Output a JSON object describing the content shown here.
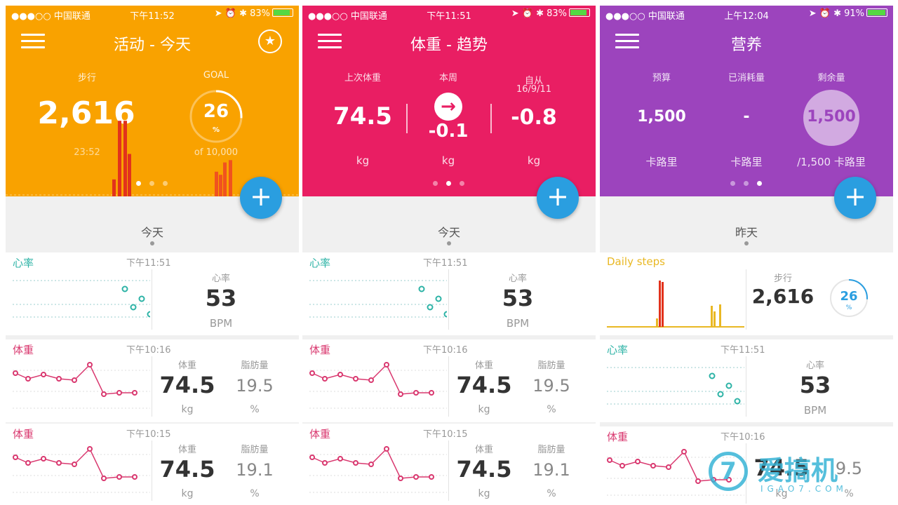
{
  "status": {
    "carrier": "●●●○○ 中国联通",
    "p1_time": "下午11:52",
    "p1_batt": "83%",
    "p2_time": "下午11:51",
    "p2_batt": "83%",
    "p3_time": "上午12:04",
    "p3_batt": "91%"
  },
  "panel1": {
    "title": "活动 - 今天",
    "steps_label": "步行",
    "steps_value": "2,616",
    "time": "23:52",
    "goal_label": "GOAL",
    "goal_pct": "26",
    "goal_pct_sym": "%",
    "goal_of": "of 10,000",
    "goal_fraction": 0.26,
    "day_label": "今天",
    "bars": [
      0.22,
      0.98,
      0.98,
      0.55,
      0.32,
      0.28,
      0.44,
      0.47
    ]
  },
  "panel2": {
    "title": "体重 - 趋势",
    "last_label": "上次体重",
    "last_value": "74.5",
    "last_unit": "kg",
    "week_label": "本周",
    "week_value": "-0.1",
    "week_unit": "kg",
    "since_label": "自从",
    "since_date": "16/9/11",
    "since_value": "-0.8",
    "since_unit": "kg",
    "day_label": "今天"
  },
  "panel3": {
    "title": "营养",
    "budget_label": "预算",
    "budget_value": "1,500",
    "budget_unit": "卡路里",
    "consumed_label": "已消耗量",
    "consumed_value": "-",
    "consumed_unit": "卡路里",
    "remain_label": "剩余量",
    "remain_value": "1,500",
    "remain_unit": "/1,500 卡路里",
    "day_label": "昨天"
  },
  "cards": {
    "heart": {
      "label": "心率",
      "time": "下午11:51",
      "stat_label": "心率",
      "value": "53",
      "unit": "BPM"
    },
    "weight1": {
      "label": "体重",
      "time": "下午10:16",
      "w_label": "体重",
      "w_value": "74.5",
      "w_unit": "kg",
      "f_label": "脂肪量",
      "f_value": "19.5",
      "f_unit": "%"
    },
    "weight2": {
      "label": "体重",
      "time": "下午10:15",
      "w_label": "体重",
      "w_value": "74.5",
      "w_unit": "kg",
      "f_label": "脂肪量",
      "f_value": "19.1",
      "f_unit": "%"
    },
    "steps": {
      "label": "Daily steps",
      "stat_label": "步行",
      "value": "2,616",
      "pct": "26",
      "pct_sym": "%",
      "fraction": 0.26
    },
    "weight3": {
      "label": "体重",
      "time": "下午10:16",
      "w_value": "74.5",
      "f_value": "9.5",
      "w_unit": "kg",
      "f_unit": "%"
    }
  },
  "watermark": {
    "name": "爱搞机",
    "domain": "IGAO7.COM",
    "logo": "7"
  },
  "colors": {
    "orange": "#f9a200",
    "pink": "#e91e63",
    "purple": "#9c44bd",
    "teal": "#2db3a6",
    "fab": "#2a9ee0",
    "weight": "#d9386f",
    "steps": "#e9b824"
  }
}
